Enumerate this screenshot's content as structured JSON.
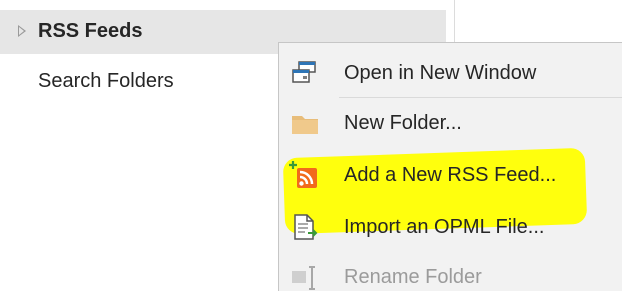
{
  "folder_pane": {
    "items": [
      {
        "label": "RSS Feeds",
        "expanded": false,
        "selected": true
      },
      {
        "label": "Search Folders"
      }
    ]
  },
  "context_menu": {
    "items": [
      {
        "label": "Open in New Window",
        "icon": "new-window-icon",
        "enabled": true
      },
      {
        "label": "New Folder...",
        "icon": "folder-icon",
        "enabled": true
      },
      {
        "label": "Add a New RSS Feed...",
        "icon": "rss-add-icon",
        "enabled": true,
        "highlighted": true
      },
      {
        "label": "Import an OPML File...",
        "icon": "import-file-icon",
        "enabled": true
      },
      {
        "label": "Rename Folder",
        "icon": "rename-icon",
        "enabled": false
      }
    ]
  },
  "colors": {
    "menu_bg": "#f2f2f2",
    "selected_row": "#e6e6e6",
    "highlight": "#ffff00",
    "rss_orange": "#f26a1b",
    "folder_tan": "#e8bd7a"
  }
}
